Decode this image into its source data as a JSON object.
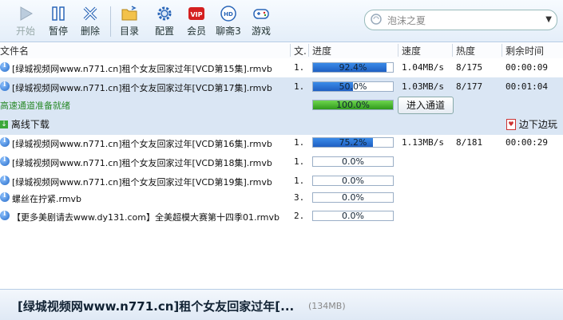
{
  "toolbar": {
    "buttons": [
      {
        "label": "开始",
        "icon": "play-icon",
        "disabled": true
      },
      {
        "label": "暂停",
        "icon": "pause-icon"
      },
      {
        "label": "删除",
        "icon": "delete-icon"
      },
      {
        "label": "目录",
        "icon": "folder-icon"
      },
      {
        "label": "配置",
        "icon": "gear-icon"
      },
      {
        "label": "会员",
        "icon": "vip-icon"
      },
      {
        "label": "聊斋3",
        "icon": "hd-icon"
      },
      {
        "label": "游戏",
        "icon": "gamepad-icon"
      }
    ],
    "vip_text": "VIP",
    "hd_text": "HD"
  },
  "search": {
    "placeholder": "泡沫之夏"
  },
  "columns": {
    "name": "文件名",
    "size": "文.",
    "progress": "进度",
    "speed": "速度",
    "heat": "热度",
    "remaining": "剩余时间"
  },
  "tasks": [
    {
      "name": "[绿城视频网www.n771.cn]租个女友回家过年[VCD第15集].rmvb",
      "size": "1.",
      "progress": 92.4,
      "progress_label": "92.4%",
      "speed": "1.04MB/s",
      "heat": "8/175",
      "remaining": "00:00:09"
    },
    {
      "name": "[绿城视频网www.n771.cn]租个女友回家过年[VCD第17集].rmvb",
      "size": "1.",
      "progress": 50.0,
      "progress_label": "50.0%",
      "speed": "1.03MB/s",
      "heat": "8/177",
      "remaining": "00:01:04",
      "selected": true
    },
    {
      "name": "[绿城视频网www.n771.cn]租个女友回家过年[VCD第16集].rmvb",
      "size": "1.",
      "progress": 75.2,
      "progress_label": "75.2%",
      "speed": "1.13MB/s",
      "heat": "8/181",
      "remaining": "00:00:29"
    },
    {
      "name": "[绿城视频网www.n771.cn]租个女友回家过年[VCD第18集].rmvb",
      "size": "1.",
      "progress": 0,
      "progress_label": "0.0%",
      "speed": "",
      "heat": "",
      "remaining": ""
    },
    {
      "name": "[绿城视频网www.n771.cn]租个女友回家过年[VCD第19集].rmvb",
      "size": "1.",
      "progress": 0,
      "progress_label": "0.0%",
      "speed": "",
      "heat": "",
      "remaining": ""
    },
    {
      "name": "螺丝在拧紧.rmvb",
      "size": "3.",
      "progress": 0,
      "progress_label": "0.0%",
      "speed": "",
      "heat": "",
      "remaining": ""
    },
    {
      "name": "【更多美剧请去www.dy131.com】全美超模大赛第十四季01.rmvb",
      "size": "2.",
      "progress": 0,
      "progress_label": "0.0%",
      "speed": "",
      "heat": "",
      "remaining": ""
    }
  ],
  "fast_channel": {
    "status": "高速通道准备就绪",
    "progress": 100,
    "progress_label": "100.0%",
    "button": "进入通道",
    "offline": "离线下载",
    "watch": "边下边玩"
  },
  "bottom": {
    "title": "[绿城视频网www.n771.cn]租个女友回家过年[...",
    "size": "(134MB)"
  }
}
